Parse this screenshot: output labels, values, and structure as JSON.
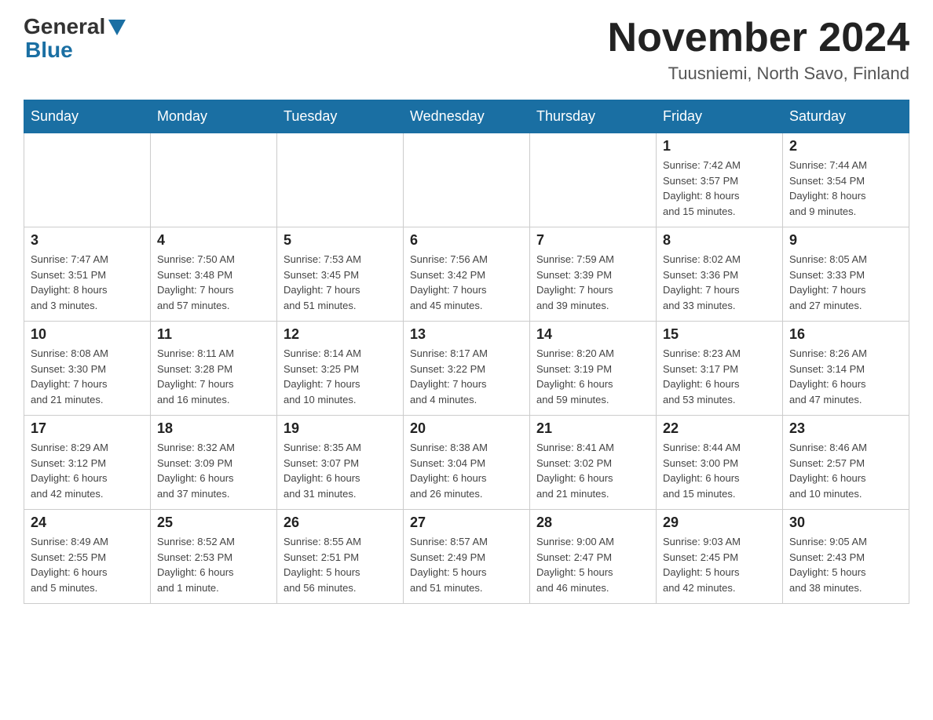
{
  "header": {
    "logo_general": "General",
    "logo_blue": "Blue",
    "month_title": "November 2024",
    "location": "Tuusniemi, North Savo, Finland"
  },
  "days_of_week": [
    "Sunday",
    "Monday",
    "Tuesday",
    "Wednesday",
    "Thursday",
    "Friday",
    "Saturday"
  ],
  "weeks": [
    [
      {
        "day": "",
        "info": ""
      },
      {
        "day": "",
        "info": ""
      },
      {
        "day": "",
        "info": ""
      },
      {
        "day": "",
        "info": ""
      },
      {
        "day": "",
        "info": ""
      },
      {
        "day": "1",
        "info": "Sunrise: 7:42 AM\nSunset: 3:57 PM\nDaylight: 8 hours\nand 15 minutes."
      },
      {
        "day": "2",
        "info": "Sunrise: 7:44 AM\nSunset: 3:54 PM\nDaylight: 8 hours\nand 9 minutes."
      }
    ],
    [
      {
        "day": "3",
        "info": "Sunrise: 7:47 AM\nSunset: 3:51 PM\nDaylight: 8 hours\nand 3 minutes."
      },
      {
        "day": "4",
        "info": "Sunrise: 7:50 AM\nSunset: 3:48 PM\nDaylight: 7 hours\nand 57 minutes."
      },
      {
        "day": "5",
        "info": "Sunrise: 7:53 AM\nSunset: 3:45 PM\nDaylight: 7 hours\nand 51 minutes."
      },
      {
        "day": "6",
        "info": "Sunrise: 7:56 AM\nSunset: 3:42 PM\nDaylight: 7 hours\nand 45 minutes."
      },
      {
        "day": "7",
        "info": "Sunrise: 7:59 AM\nSunset: 3:39 PM\nDaylight: 7 hours\nand 39 minutes."
      },
      {
        "day": "8",
        "info": "Sunrise: 8:02 AM\nSunset: 3:36 PM\nDaylight: 7 hours\nand 33 minutes."
      },
      {
        "day": "9",
        "info": "Sunrise: 8:05 AM\nSunset: 3:33 PM\nDaylight: 7 hours\nand 27 minutes."
      }
    ],
    [
      {
        "day": "10",
        "info": "Sunrise: 8:08 AM\nSunset: 3:30 PM\nDaylight: 7 hours\nand 21 minutes."
      },
      {
        "day": "11",
        "info": "Sunrise: 8:11 AM\nSunset: 3:28 PM\nDaylight: 7 hours\nand 16 minutes."
      },
      {
        "day": "12",
        "info": "Sunrise: 8:14 AM\nSunset: 3:25 PM\nDaylight: 7 hours\nand 10 minutes."
      },
      {
        "day": "13",
        "info": "Sunrise: 8:17 AM\nSunset: 3:22 PM\nDaylight: 7 hours\nand 4 minutes."
      },
      {
        "day": "14",
        "info": "Sunrise: 8:20 AM\nSunset: 3:19 PM\nDaylight: 6 hours\nand 59 minutes."
      },
      {
        "day": "15",
        "info": "Sunrise: 8:23 AM\nSunset: 3:17 PM\nDaylight: 6 hours\nand 53 minutes."
      },
      {
        "day": "16",
        "info": "Sunrise: 8:26 AM\nSunset: 3:14 PM\nDaylight: 6 hours\nand 47 minutes."
      }
    ],
    [
      {
        "day": "17",
        "info": "Sunrise: 8:29 AM\nSunset: 3:12 PM\nDaylight: 6 hours\nand 42 minutes."
      },
      {
        "day": "18",
        "info": "Sunrise: 8:32 AM\nSunset: 3:09 PM\nDaylight: 6 hours\nand 37 minutes."
      },
      {
        "day": "19",
        "info": "Sunrise: 8:35 AM\nSunset: 3:07 PM\nDaylight: 6 hours\nand 31 minutes."
      },
      {
        "day": "20",
        "info": "Sunrise: 8:38 AM\nSunset: 3:04 PM\nDaylight: 6 hours\nand 26 minutes."
      },
      {
        "day": "21",
        "info": "Sunrise: 8:41 AM\nSunset: 3:02 PM\nDaylight: 6 hours\nand 21 minutes."
      },
      {
        "day": "22",
        "info": "Sunrise: 8:44 AM\nSunset: 3:00 PM\nDaylight: 6 hours\nand 15 minutes."
      },
      {
        "day": "23",
        "info": "Sunrise: 8:46 AM\nSunset: 2:57 PM\nDaylight: 6 hours\nand 10 minutes."
      }
    ],
    [
      {
        "day": "24",
        "info": "Sunrise: 8:49 AM\nSunset: 2:55 PM\nDaylight: 6 hours\nand 5 minutes."
      },
      {
        "day": "25",
        "info": "Sunrise: 8:52 AM\nSunset: 2:53 PM\nDaylight: 6 hours\nand 1 minute."
      },
      {
        "day": "26",
        "info": "Sunrise: 8:55 AM\nSunset: 2:51 PM\nDaylight: 5 hours\nand 56 minutes."
      },
      {
        "day": "27",
        "info": "Sunrise: 8:57 AM\nSunset: 2:49 PM\nDaylight: 5 hours\nand 51 minutes."
      },
      {
        "day": "28",
        "info": "Sunrise: 9:00 AM\nSunset: 2:47 PM\nDaylight: 5 hours\nand 46 minutes."
      },
      {
        "day": "29",
        "info": "Sunrise: 9:03 AM\nSunset: 2:45 PM\nDaylight: 5 hours\nand 42 minutes."
      },
      {
        "day": "30",
        "info": "Sunrise: 9:05 AM\nSunset: 2:43 PM\nDaylight: 5 hours\nand 38 minutes."
      }
    ]
  ]
}
